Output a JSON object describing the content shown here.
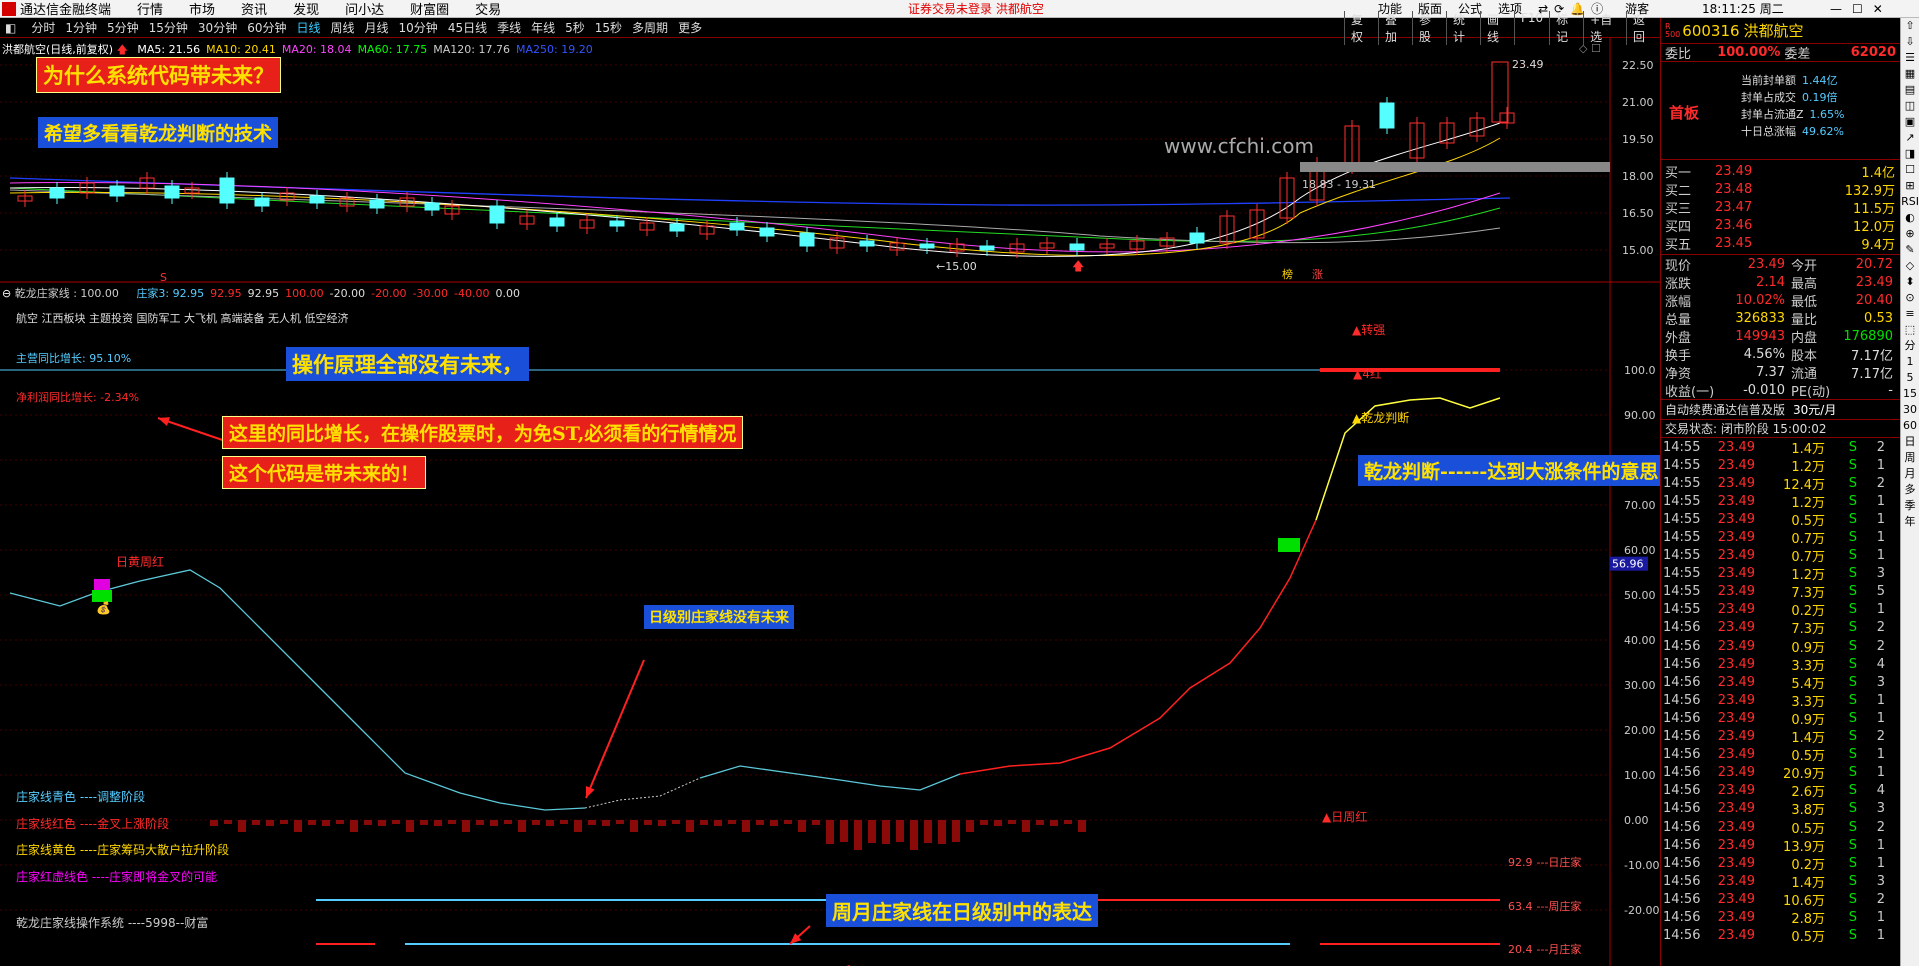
{
  "app": {
    "title": "通达信金融终端",
    "menu": [
      "行情",
      "市场",
      "资讯",
      "发现",
      "问小达",
      "财富圈",
      "交易"
    ],
    "warning": "证券交易未登录  洪都航空",
    "right_menu": [
      "功能",
      "版面",
      "公式",
      "选项"
    ],
    "user": "游客",
    "clock": "18:11:25 周二"
  },
  "periods": {
    "items": [
      "分时",
      "1分钟",
      "5分钟",
      "15分钟",
      "30分钟",
      "60分钟",
      "日线",
      "周线",
      "月线",
      "10分钟",
      "45日线",
      "季线",
      "年线",
      "5秒",
      "15秒",
      "多周期",
      "更多"
    ],
    "active": "日线",
    "tools": [
      "复权",
      "叠加",
      "参股",
      "统计",
      "画线",
      "F10",
      "标记",
      "+自选",
      "返回"
    ]
  },
  "kline": {
    "name": "洪都航空(日线,前复权)",
    "ma": [
      {
        "label": "MA5: 21.56",
        "color": "#ffffff"
      },
      {
        "label": "MA10: 20.41",
        "color": "#ffd700"
      },
      {
        "label": "MA20: 18.04",
        "color": "#ff44ff"
      },
      {
        "label": "MA60: 17.75",
        "color": "#00ff00"
      },
      {
        "label": "MA120: 17.76",
        "color": "#cccccc"
      },
      {
        "label": "MA250: 19.20",
        "color": "#3355ff"
      }
    ],
    "y_ticks": [
      "22.50",
      "21.00",
      "19.50",
      "18.00",
      "16.50",
      "15.00"
    ],
    "high_label": "23.49",
    "low_label": "15.00",
    "range_label": "18.83 - 19.31",
    "watermark": "www.cfchi.com",
    "marks": [
      "榜",
      "涨"
    ]
  },
  "indicator": {
    "name": "乾龙庄家线 : 100.00",
    "values": [
      "庄家3: 92.95",
      "92.95",
      "92.95",
      "100.00",
      "-20.00",
      "-20.00",
      "-30.00",
      "-40.00",
      "0.00"
    ],
    "value_colors": [
      "#5cf",
      "#ff2a2a",
      "#ddd",
      "#ff2a2a",
      "#ddd",
      "#ff2a2a",
      "#ff2a2a",
      "#ff2a2a",
      "#ddd"
    ],
    "blocks": "航空 江西板块 主题投资 国防军工 大飞机 高端装备 无人机 低空经济",
    "y_ticks": [
      "100.0",
      "90.00",
      "80.00",
      "70.00",
      "60.00",
      "50.00",
      "40.00",
      "30.00",
      "20.00",
      "10.00",
      "0.00",
      "-10.00",
      "-20.00"
    ],
    "marker_value": "56.96",
    "revenue_growth": "主营同比增长: 95.10%",
    "profit_growth": "净利润同比增长: -2.34%",
    "labels": {
      "zhuanqiang": "转强",
      "sihong": "4红",
      "qianlong": "乾龙判断",
      "rihuangzhouhong": "日黄周红",
      "rizhouhong": "日周红"
    },
    "legend": [
      {
        "text": "庄家线青色 ----调整阶段",
        "color": "#5cf"
      },
      {
        "text": "庄家线红色 ----金叉上涨阶段",
        "color": "#ff2a2a"
      },
      {
        "text": "庄家线黄色 ----庄家筹码大散户拉升阶段",
        "color": "#ffd700"
      },
      {
        "text": "庄家红虚线色 ----庄家即将金叉的可能",
        "color": "#f0f"
      }
    ],
    "system": "乾龙庄家线操作系统 ----5998--财富",
    "lines": [
      {
        "value": "92.9",
        "label": "---日庄家"
      },
      {
        "value": "63.4",
        "label": "---周庄家"
      },
      {
        "value": "20.4",
        "label": "---月庄家"
      }
    ]
  },
  "annotations": {
    "q1": "为什么系统代码带未来？",
    "q2": "希望多看看乾龙判断的技术",
    "a1": "操作原理全部没有未来，",
    "a2": "这里的同比增长，在操作股票时，为免ST,必须看的行情情况",
    "a3": "这个代码是带未来的！",
    "a4": "日级别庄家线没有未来",
    "a5": "乾龙判断------达到大涨条件的意思",
    "a6": "周月庄家线在日级别中的表达"
  },
  "quote": {
    "code": "600316",
    "name": "洪都航空",
    "webi_label": "委比",
    "webi": "100.00%",
    "wecha_label": "委差",
    "wecha": "62020",
    "board": "首板",
    "seal_lines": [
      {
        "label": "当前封单额",
        "value": "1.44亿"
      },
      {
        "label": "封单占成交",
        "value": "0.19倍"
      },
      {
        "label": "封单占流通Z",
        "value": "1.65%"
      },
      {
        "label": "十日总涨幅",
        "value": "49.62%"
      }
    ],
    "bids": [
      {
        "label": "买一",
        "price": "23.49",
        "vol": "1.4亿"
      },
      {
        "label": "买二",
        "price": "23.48",
        "vol": "132.9万"
      },
      {
        "label": "买三",
        "price": "23.47",
        "vol": "11.5万"
      },
      {
        "label": "买四",
        "price": "23.46",
        "vol": "12.0万"
      },
      {
        "label": "买五",
        "price": "23.45",
        "vol": "9.4万"
      }
    ],
    "stats": [
      {
        "l1": "现价",
        "v1": "23.49",
        "c1": "#ff2a2a",
        "l2": "今开",
        "v2": "20.72",
        "c2": "#ff2a2a"
      },
      {
        "l1": "涨跌",
        "v1": "2.14",
        "c1": "#ff2a2a",
        "l2": "最高",
        "v2": "23.49",
        "c2": "#ff2a2a"
      },
      {
        "l1": "涨幅",
        "v1": "10.02%",
        "c1": "#ff2a2a",
        "l2": "最低",
        "v2": "20.40",
        "c2": "#ff2a2a"
      },
      {
        "l1": "总量",
        "v1": "326833",
        "c1": "#ffd700",
        "l2": "量比",
        "v2": "0.53",
        "c2": "#ffd700"
      },
      {
        "l1": "外盘",
        "v1": "149943",
        "c1": "#ff2a2a",
        "l2": "内盘",
        "v2": "176890",
        "c2": "#00e000"
      },
      {
        "l1": "换手",
        "v1": "4.56%",
        "c1": "#ddd",
        "l2": "股本",
        "v2": "7.17亿",
        "c2": "#ddd"
      },
      {
        "l1": "净资",
        "v1": "7.37",
        "c1": "#ddd",
        "l2": "流通",
        "v2": "7.17亿",
        "c2": "#ddd"
      },
      {
        "l1": "收益(一)",
        "v1": "-0.010",
        "c1": "#ddd",
        "l2": "PE(动)",
        "v2": "-",
        "c2": "#ddd"
      }
    ],
    "promo": "自动续费通达信普及版",
    "promo_price": "30元/月",
    "trade_status": "交易状态: 闭市阶段 15:00:02"
  },
  "trades": [
    [
      "14:55",
      "23.49",
      "1.4万",
      "S",
      "2"
    ],
    [
      "14:55",
      "23.49",
      "1.2万",
      "S",
      "1"
    ],
    [
      "14:55",
      "23.49",
      "12.4万",
      "S",
      "2"
    ],
    [
      "14:55",
      "23.49",
      "1.2万",
      "S",
      "1"
    ],
    [
      "14:55",
      "23.49",
      "0.5万",
      "S",
      "1"
    ],
    [
      "14:55",
      "23.49",
      "0.7万",
      "S",
      "1"
    ],
    [
      "14:55",
      "23.49",
      "0.7万",
      "S",
      "1"
    ],
    [
      "14:55",
      "23.49",
      "1.2万",
      "S",
      "3"
    ],
    [
      "14:55",
      "23.49",
      "7.3万",
      "S",
      "5"
    ],
    [
      "14:55",
      "23.49",
      "0.2万",
      "S",
      "1"
    ],
    [
      "14:56",
      "23.49",
      "7.3万",
      "S",
      "2"
    ],
    [
      "14:56",
      "23.49",
      "0.9万",
      "S",
      "2"
    ],
    [
      "14:56",
      "23.49",
      "3.3万",
      "S",
      "4"
    ],
    [
      "14:56",
      "23.49",
      "5.4万",
      "S",
      "3"
    ],
    [
      "14:56",
      "23.49",
      "3.3万",
      "S",
      "1"
    ],
    [
      "14:56",
      "23.49",
      "0.9万",
      "S",
      "1"
    ],
    [
      "14:56",
      "23.49",
      "1.4万",
      "S",
      "2"
    ],
    [
      "14:56",
      "23.49",
      "0.5万",
      "S",
      "1"
    ],
    [
      "14:56",
      "23.49",
      "20.9万",
      "S",
      "1"
    ],
    [
      "14:56",
      "23.49",
      "2.6万",
      "S",
      "4"
    ],
    [
      "14:56",
      "23.49",
      "3.8万",
      "S",
      "3"
    ],
    [
      "14:56",
      "23.49",
      "0.5万",
      "S",
      "2"
    ],
    [
      "14:56",
      "23.49",
      "13.9万",
      "S",
      "1"
    ],
    [
      "14:56",
      "23.49",
      "0.2万",
      "S",
      "1"
    ],
    [
      "14:56",
      "23.49",
      "1.4万",
      "S",
      "3"
    ],
    [
      "14:56",
      "23.49",
      "10.6万",
      "S",
      "2"
    ],
    [
      "14:56",
      "23.49",
      "2.8万",
      "S",
      "1"
    ],
    [
      "14:56",
      "23.49",
      "0.5万",
      "S",
      "1"
    ]
  ],
  "sidebar": [
    "分",
    "1",
    "5",
    "15",
    "30",
    "60",
    "日",
    "周",
    "月",
    "多",
    "季",
    "年"
  ]
}
